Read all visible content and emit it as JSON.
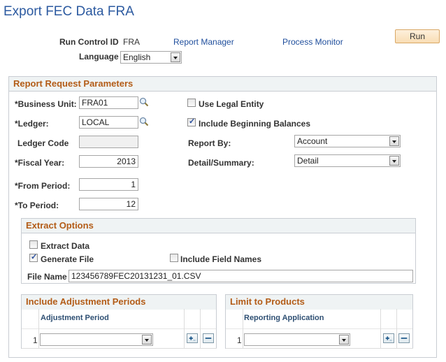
{
  "page": {
    "title": "Export FEC Data FRA"
  },
  "header": {
    "run_control_label": "Run Control ID",
    "run_control_value": "FRA",
    "report_manager_link": "Report Manager",
    "process_monitor_link": "Process Monitor",
    "run_button": "Run",
    "language_label": "Language",
    "language_value": "English"
  },
  "params": {
    "section_title": "Report Request Parameters",
    "business_unit_label": "*Business Unit:",
    "business_unit_value": "FRA01",
    "ledger_label": "*Ledger:",
    "ledger_value": "LOCAL",
    "ledger_code_label": "Ledger Code",
    "ledger_code_value": "",
    "fiscal_year_label": "*Fiscal Year:",
    "fiscal_year_value": "2013",
    "from_period_label": "*From Period:",
    "from_period_value": "1",
    "to_period_label": "*To Period:",
    "to_period_value": "12",
    "use_legal_entity_label": "Use Legal Entity",
    "use_legal_entity_checked": false,
    "include_beginning_balances_label": "Include Beginning Balances",
    "include_beginning_balances_checked": true,
    "report_by_label": "Report By:",
    "report_by_value": "Account",
    "detail_summary_label": "Detail/Summary:",
    "detail_summary_value": "Detail"
  },
  "extract": {
    "section_title": "Extract Options",
    "extract_data_label": "Extract Data",
    "extract_data_checked": false,
    "generate_file_label": "Generate File",
    "generate_file_checked": true,
    "include_field_names_label": "Include Field Names",
    "include_field_names_checked": false,
    "file_name_label": "File Name",
    "file_name_value": "123456789FEC20131231_01.CSV"
  },
  "adjustment": {
    "section_title": "Include Adjustment Periods",
    "column_header": "Adjustment Period",
    "rows": [
      {
        "num": "1",
        "value": ""
      }
    ]
  },
  "products": {
    "section_title": "Limit to Products",
    "column_header": "Reporting Application",
    "rows": [
      {
        "num": "1",
        "value": ""
      }
    ]
  },
  "colors": {
    "title": "#2c5aa0",
    "section_header_text": "#b35c17",
    "section_header_bg": "#eff3f4",
    "link": "#1f4e9c",
    "run_button_bg": "#f9ddb4"
  }
}
